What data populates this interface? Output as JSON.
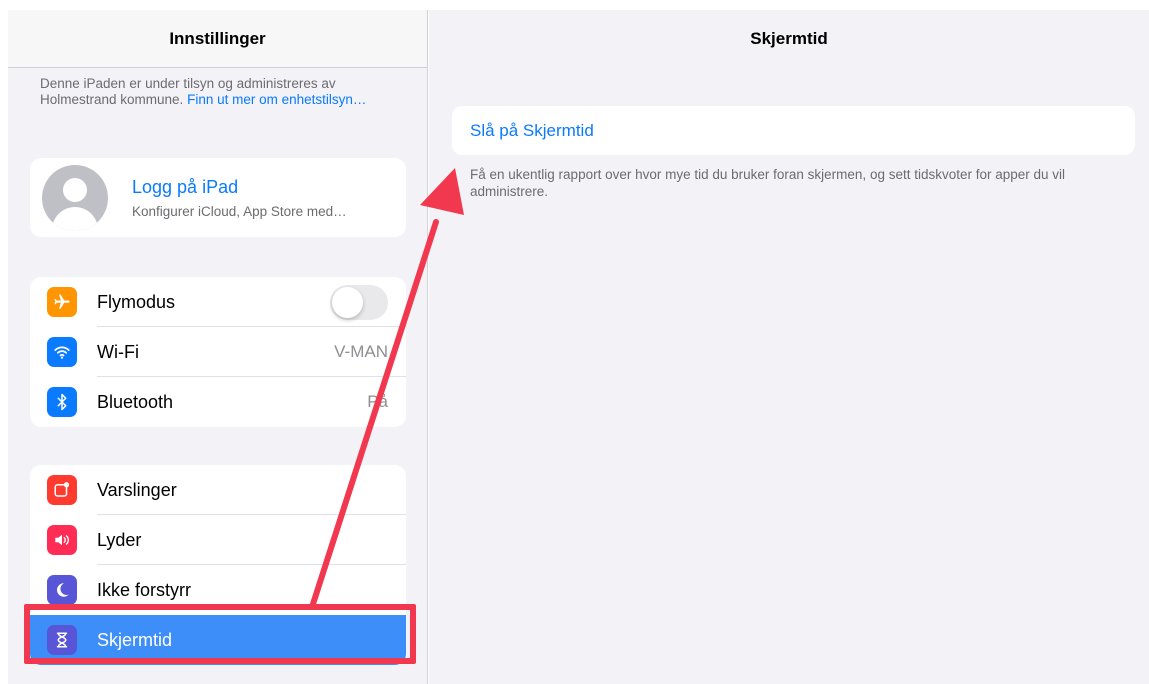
{
  "sidebar": {
    "title": "Innstillinger",
    "notice_text": "Denne iPaden er under tilsyn og administreres av Holmestrand kommune.",
    "notice_link": "Finn ut mer om enhetstilsyn…",
    "profile": {
      "title": "Logg på iPad",
      "subtitle": "Konfigurer iCloud, App Store med…"
    },
    "network": [
      {
        "label": "Flymodus",
        "icon": "airplane-icon",
        "color": "#ff9500"
      },
      {
        "label": "Wi-Fi",
        "value": "V-MAN",
        "icon": "wifi-icon",
        "color": "#0a7aff"
      },
      {
        "label": "Bluetooth",
        "value": "På",
        "icon": "bluetooth-icon",
        "color": "#0a7aff"
      }
    ],
    "general": [
      {
        "label": "Varslinger",
        "icon": "notifications-icon",
        "color": "#ff3b30"
      },
      {
        "label": "Lyder",
        "icon": "speaker-icon",
        "color": "#ff2d55"
      },
      {
        "label": "Ikke forstyrr",
        "icon": "moon-icon",
        "color": "#5856d6"
      },
      {
        "label": "Skjermtid",
        "icon": "hourglass-icon",
        "color": "#5856d6",
        "selected": true
      }
    ]
  },
  "main": {
    "title": "Skjermtid",
    "turn_on_label": "Slå på Skjermtid",
    "footnote": "Få en ukentlig rapport over hvor mye tid du bruker foran skjermen, og sett tidskvoter for apper du vil administrere."
  },
  "annotation": {
    "color": "#f2384f"
  }
}
